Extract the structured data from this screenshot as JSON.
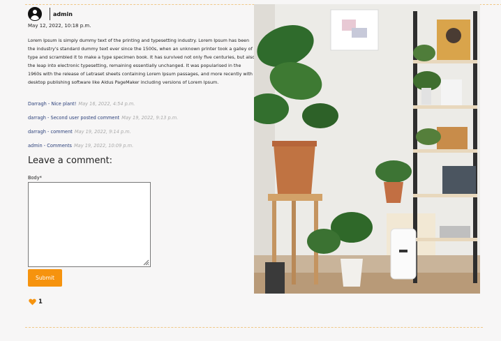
{
  "post": {
    "author": "admin",
    "date": "May 12, 2022, 10:18 p.m.",
    "body": "Lorem Ipsum is simply dummy text of the printing and typesetting industry. Lorem Ipsum has been the industry's standard dummy text ever since the 1500s, when an unknown printer took a galley of type and scrambled it to make a type specimen book. It has survived not only five centuries, but also the leap into electronic typesetting, remaining essentially unchanged. It was popularised in the 1960s with the release of Letraset sheets containing Lorem Ipsum passages, and more recently with desktop publishing software like Aldus PageMaker including versions of Lorem Ipsum.",
    "image_icon": "photo-houseplants"
  },
  "comments": [
    {
      "text": "Darragh - Nice plant!",
      "date": "May 16, 2022, 4:54 p.m."
    },
    {
      "text": "darragh - Second user posted comment",
      "date": "May 19, 2022, 9:13 p.m."
    },
    {
      "text": "darragh - comment",
      "date": "May 19, 2022, 9:14 p.m."
    },
    {
      "text": "admin - Comments",
      "date": "May 19, 2022, 10:09 p.m."
    }
  ],
  "form": {
    "title": "Leave a comment:",
    "body_label": "Body*",
    "body_value": "",
    "submit_label": "Submit"
  },
  "likes": {
    "count": "1",
    "icon": "heart-icon"
  },
  "colors": {
    "accent": "#f6930e",
    "link": "#2a3f7a",
    "muted": "#a9a9a9",
    "divider": "#f0c887"
  }
}
